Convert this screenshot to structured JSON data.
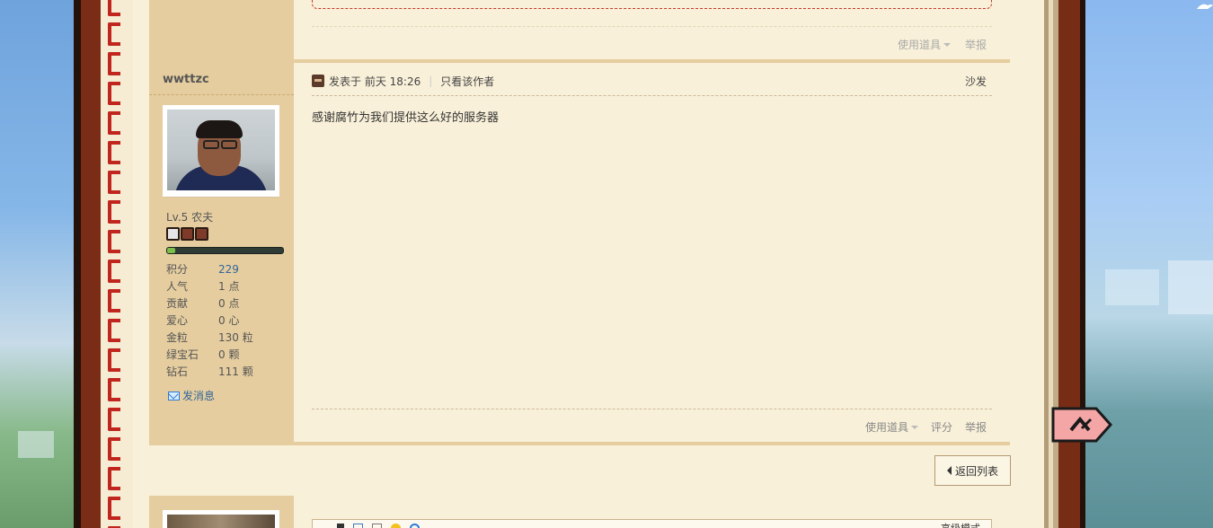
{
  "previous_post": {
    "actions": [
      {
        "label": "使用道具",
        "has_caret": true
      },
      {
        "label": "举报",
        "has_caret": false
      }
    ]
  },
  "post": {
    "author": {
      "name": "wwttzc",
      "level": "Lv.5 农夫",
      "xp_fraction": 0.07,
      "stats": [
        {
          "label": "积分",
          "value": "229",
          "link": true
        },
        {
          "label": "人气",
          "value": "1 点",
          "link": false
        },
        {
          "label": "贡献",
          "value": "0 点",
          "link": false
        },
        {
          "label": "爱心",
          "value": "0 心",
          "link": false
        },
        {
          "label": "金粒",
          "value": "130 粒",
          "link": false
        },
        {
          "label": "绿宝石",
          "value": "0 颗",
          "link": false
        },
        {
          "label": "钻石",
          "value": "111 颗",
          "link": false
        }
      ],
      "send_message": "发消息"
    },
    "meta": {
      "posted_prefix": "发表于",
      "posted_time": "前天 18:26",
      "pipe": "|",
      "only_author": "只看该作者",
      "floor": "沙发"
    },
    "content": "感谢腐竹为我们提供这么好的服务器",
    "actions": [
      {
        "label": "使用道具",
        "has_caret": true
      },
      {
        "label": "评分",
        "has_caret": false
      },
      {
        "label": "举报",
        "has_caret": false
      }
    ]
  },
  "back_to_list": "返回列表",
  "reply_editor": {
    "advanced_label": "高级模式"
  },
  "colors": {
    "page": "#f9f0d9",
    "sidebar": "#e5cd9f",
    "link": "#336699",
    "cover": "#772c16",
    "stitch": "#c0261d"
  }
}
